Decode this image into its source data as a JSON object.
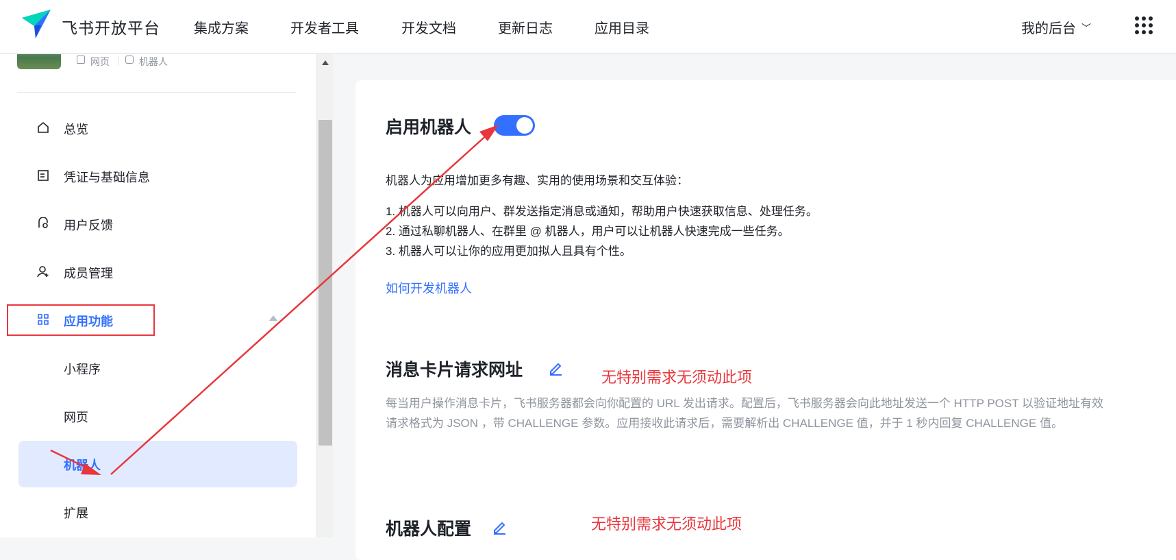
{
  "header": {
    "brand": "飞书开放平台",
    "nav": [
      "集成方案",
      "开发者工具",
      "开发文档",
      "更新日志",
      "应用目录"
    ],
    "backstage_label": "我的后台",
    "backstage_chevron": "﹀",
    "brand_color": "#3370ff"
  },
  "app_meta": {
    "tags": [
      "网页",
      "机器人"
    ]
  },
  "sidebar": {
    "items": [
      {
        "label": "总览",
        "icon": "home-icon"
      },
      {
        "label": "凭证与基础信息",
        "icon": "credential-icon"
      },
      {
        "label": "用户反馈",
        "icon": "feedback-icon"
      },
      {
        "label": "成员管理",
        "icon": "member-icon"
      },
      {
        "label": "应用功能",
        "icon": "apps-grid-icon",
        "expanded": true
      }
    ],
    "sub_items": [
      {
        "label": "小程序",
        "active": false
      },
      {
        "label": "网页",
        "active": false
      },
      {
        "label": "机器人",
        "active": true
      },
      {
        "label": "扩展",
        "active": false
      }
    ]
  },
  "bot_section": {
    "title": "启用机器人",
    "enabled": true,
    "intro": "机器人为应用增加更多有趣、实用的使用场景和交互体验：",
    "points": [
      "1. 机器人可以向用户、群发送指定消息或通知，帮助用户快速获取信息、处理任务。",
      "2. 通过私聊机器人、在群里 @ 机器人，用户可以让机器人快速完成一些任务。",
      "3. 机器人可以让你的应用更加拟人且具有个性。"
    ],
    "link": "如何开发机器人"
  },
  "card_url_section": {
    "title": "消息卡片请求网址",
    "desc_line1": "每当用户操作消息卡片，飞书服务器都会向你配置的 URL 发出请求。配置后，飞书服务器会向此地址发送一个 HTTP POST 以验证地址有效",
    "desc_line2": "请求格式为 JSON ，带 CHALLENGE 参数。应用接收此请求后，需要解析出 CHALLENGE 值，并于 1 秒内回复 CHALLENGE 值。"
  },
  "bot_config_section": {
    "title": "机器人配置"
  },
  "annotations": {
    "note1": "无特别需求无须动此项",
    "note2": "无特别需求无须动此项",
    "color": "#e8363b"
  }
}
